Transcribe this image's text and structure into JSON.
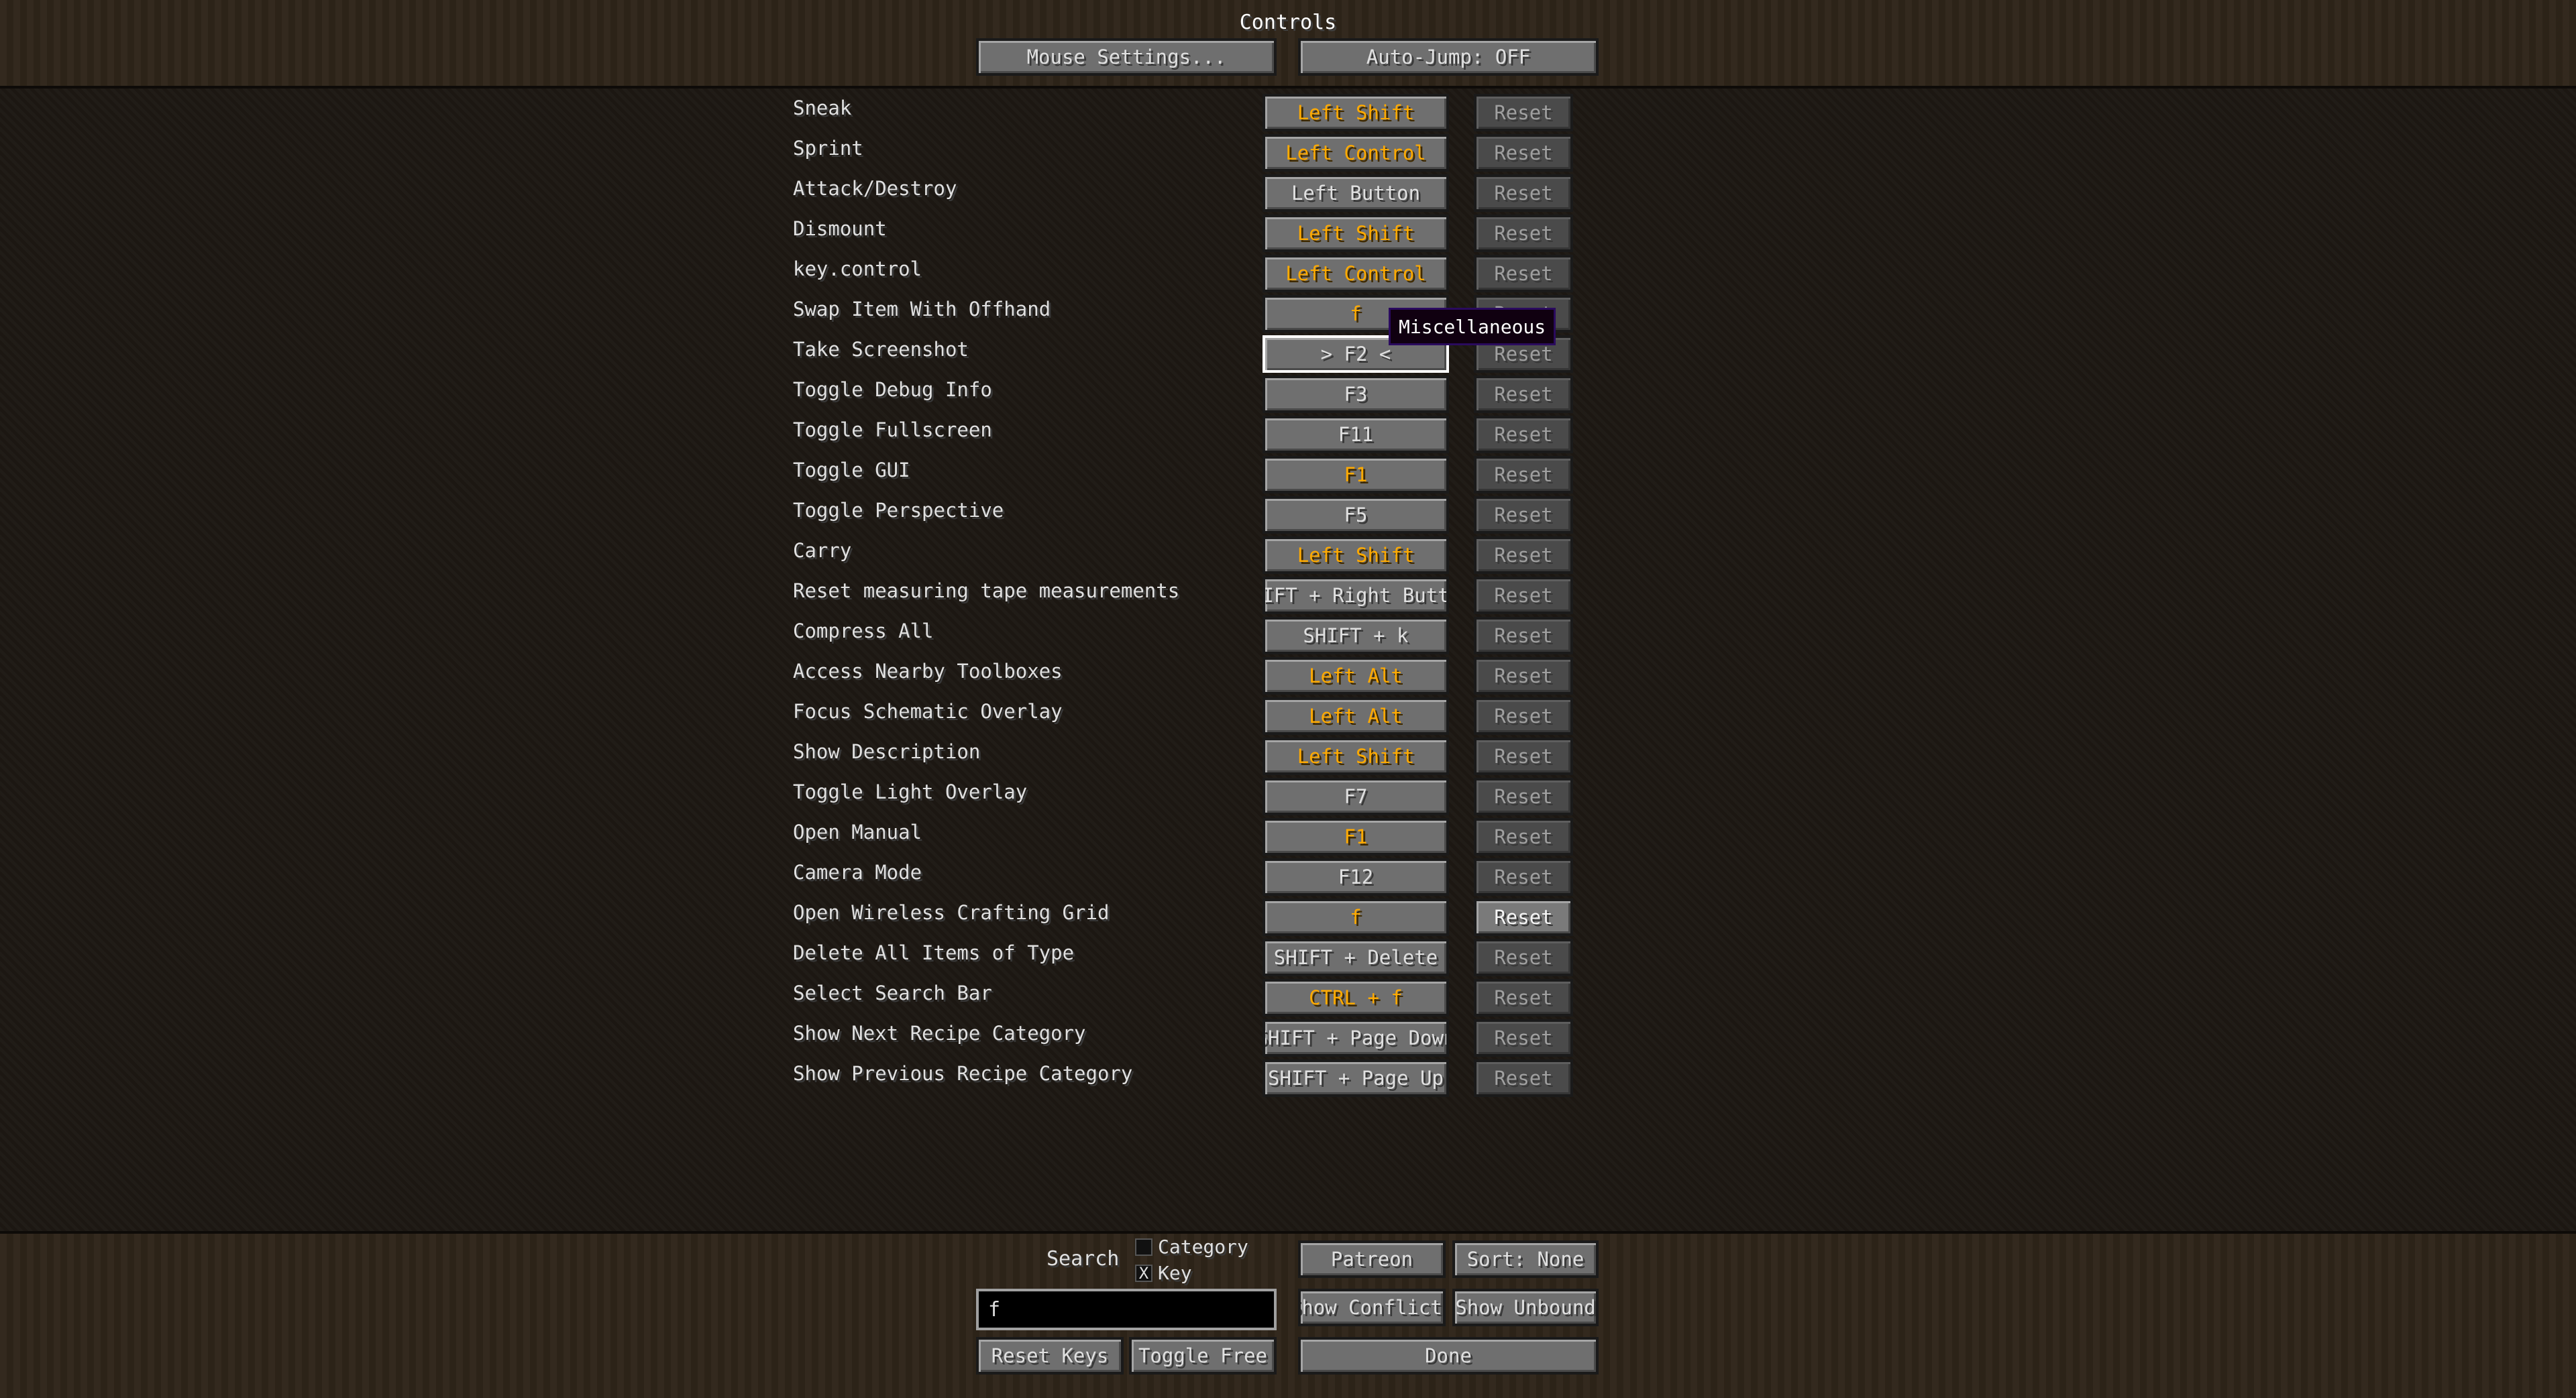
{
  "title": "Controls",
  "top_buttons": {
    "mouse_settings": "Mouse Settings...",
    "auto_jump": "Auto-Jump: OFF"
  },
  "keybinds": [
    {
      "action": "Sneak",
      "key": "Left Shift",
      "conflict": true,
      "reset": "Reset"
    },
    {
      "action": "Sprint",
      "key": "Left Control",
      "conflict": true,
      "reset": "Reset"
    },
    {
      "action": "Attack/Destroy",
      "key": "Left Button",
      "conflict": false,
      "reset": "Reset"
    },
    {
      "action": "Dismount",
      "key": "Left Shift",
      "conflict": true,
      "reset": "Reset"
    },
    {
      "action": "key.control",
      "key": "Left Control",
      "conflict": true,
      "reset": "Reset"
    },
    {
      "action": "Swap Item With Offhand",
      "key": "f",
      "conflict": true,
      "reset": "Reset"
    },
    {
      "action": "Take Screenshot",
      "key": "> F2 <",
      "conflict": false,
      "reset": "Reset",
      "focused": true
    },
    {
      "action": "Toggle Debug Info",
      "key": "F3",
      "conflict": false,
      "reset": "Reset"
    },
    {
      "action": "Toggle Fullscreen",
      "key": "F11",
      "conflict": false,
      "reset": "Reset"
    },
    {
      "action": "Toggle GUI",
      "key": "F1",
      "conflict": true,
      "reset": "Reset"
    },
    {
      "action": "Toggle Perspective",
      "key": "F5",
      "conflict": false,
      "reset": "Reset"
    },
    {
      "action": "Carry",
      "key": "Left Shift",
      "conflict": true,
      "reset": "Reset"
    },
    {
      "action": "Reset measuring tape measurements",
      "key": "SHIFT + Right Button",
      "conflict": false,
      "reset": "Reset"
    },
    {
      "action": "Compress All",
      "key": "SHIFT + k",
      "conflict": false,
      "reset": "Reset"
    },
    {
      "action": "Access Nearby Toolboxes",
      "key": "Left Alt",
      "conflict": true,
      "reset": "Reset"
    },
    {
      "action": "Focus Schematic Overlay",
      "key": "Left Alt",
      "conflict": true,
      "reset": "Reset"
    },
    {
      "action": "Show Description",
      "key": "Left Shift",
      "conflict": true,
      "reset": "Reset"
    },
    {
      "action": "Toggle Light Overlay",
      "key": "F7",
      "conflict": false,
      "reset": "Reset"
    },
    {
      "action": "Open Manual",
      "key": "F1",
      "conflict": true,
      "reset": "Reset"
    },
    {
      "action": "Camera Mode",
      "key": "F12",
      "conflict": false,
      "reset": "Reset"
    },
    {
      "action": "Open Wireless Crafting Grid",
      "key": "f",
      "conflict": true,
      "reset": "Reset",
      "reset_enabled": true
    },
    {
      "action": "Delete All Items of Type",
      "key": "SHIFT + Delete",
      "conflict": false,
      "reset": "Reset"
    },
    {
      "action": "Select Search Bar",
      "key": "CTRL + f",
      "conflict": true,
      "reset": "Reset"
    },
    {
      "action": "Show Next Recipe Category",
      "key": "SHIFT + Page Down",
      "conflict": false,
      "reset": "Reset"
    },
    {
      "action": "Show Previous Recipe Category",
      "key": "SHIFT + Page Up",
      "conflict": false,
      "reset": "Reset"
    }
  ],
  "tooltip": "Miscellaneous",
  "search": {
    "label": "Search",
    "value": "f",
    "category_label": "Category",
    "category_checked": false,
    "key_label": "Key",
    "key_checked": true,
    "key_check_mark": "X"
  },
  "bottom_buttons": {
    "patreon": "Patreon",
    "sort": "Sort: None",
    "show_conflicts": "Show Conflicts",
    "show_unbound": "Show Unbound",
    "reset_keys": "Reset Keys",
    "toggle_free": "Toggle Free",
    "done": "Done"
  },
  "colors": {
    "conflict": "#ffaa00",
    "text": "#e0e0e0"
  }
}
